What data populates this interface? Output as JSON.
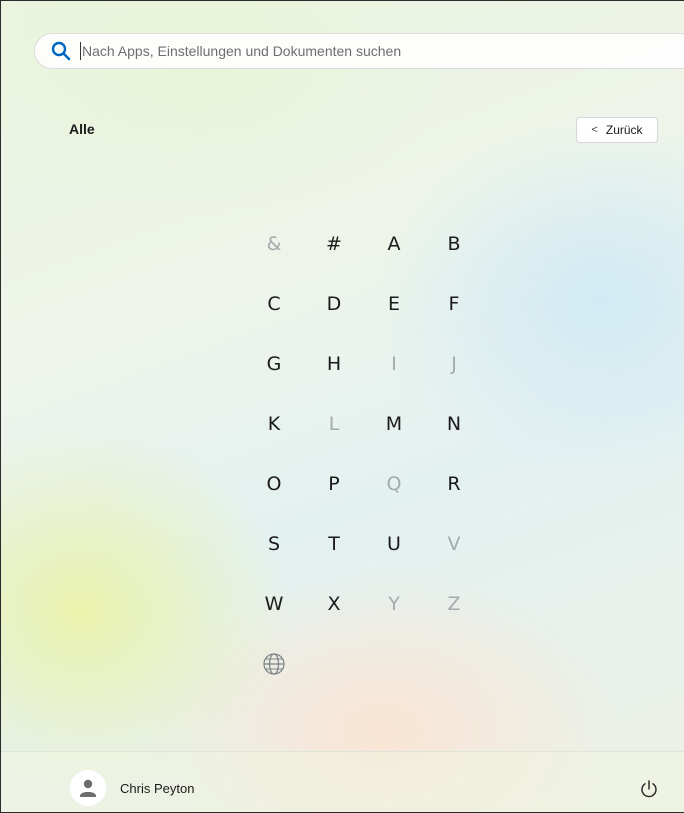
{
  "search": {
    "placeholder": "Nach Apps, Einstellungen und Dokumenten suchen"
  },
  "header": {
    "title": "Alle",
    "back_label": "Zurück"
  },
  "letters": [
    {
      "label": "&",
      "enabled": false
    },
    {
      "label": "#",
      "enabled": true
    },
    {
      "label": "A",
      "enabled": true
    },
    {
      "label": "B",
      "enabled": true
    },
    {
      "label": "C",
      "enabled": true
    },
    {
      "label": "D",
      "enabled": true
    },
    {
      "label": "E",
      "enabled": true
    },
    {
      "label": "F",
      "enabled": true
    },
    {
      "label": "G",
      "enabled": true
    },
    {
      "label": "H",
      "enabled": true
    },
    {
      "label": "I",
      "enabled": false
    },
    {
      "label": "J",
      "enabled": false
    },
    {
      "label": "K",
      "enabled": true
    },
    {
      "label": "L",
      "enabled": false
    },
    {
      "label": "M",
      "enabled": true
    },
    {
      "label": "N",
      "enabled": true
    },
    {
      "label": "O",
      "enabled": true
    },
    {
      "label": "P",
      "enabled": true
    },
    {
      "label": "Q",
      "enabled": false
    },
    {
      "label": "R",
      "enabled": true
    },
    {
      "label": "S",
      "enabled": true
    },
    {
      "label": "T",
      "enabled": true
    },
    {
      "label": "U",
      "enabled": true
    },
    {
      "label": "V",
      "enabled": false
    },
    {
      "label": "W",
      "enabled": true
    },
    {
      "label": "X",
      "enabled": true
    },
    {
      "label": "Y",
      "enabled": false
    },
    {
      "label": "Z",
      "enabled": false
    }
  ],
  "globe_icon": "globe-icon",
  "footer": {
    "user_name": "Chris Peyton",
    "avatar_icon": "person-icon",
    "power_icon": "power-icon"
  },
  "colors": {
    "accent": "#0067c0",
    "text": "#1a1a1a",
    "disabled_letter": "#a4abac"
  }
}
